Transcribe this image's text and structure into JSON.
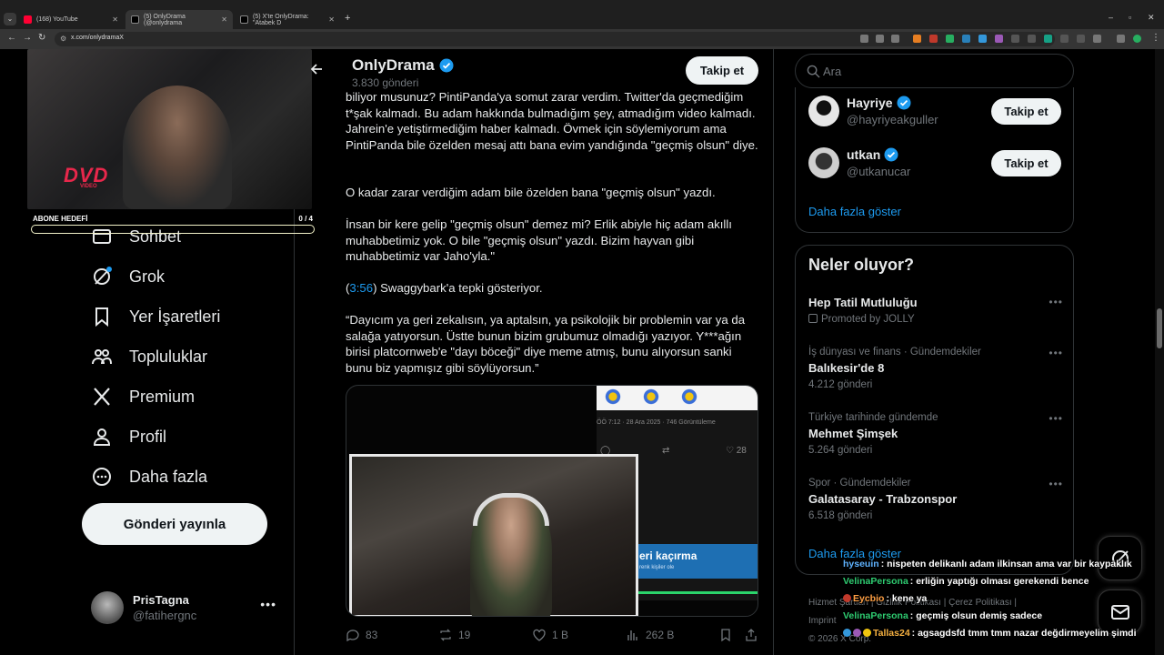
{
  "browser": {
    "tabs": [
      {
        "title": "(168) YouTube",
        "color": "#ff0033"
      },
      {
        "title": "(5) OnlyDrama (@onlydrama",
        "color": "#ffffff"
      },
      {
        "title": "(5) X'te OnlyDrama: \"Atabek D",
        "color": "#ffffff"
      }
    ],
    "url": "x.com/onlydramaX"
  },
  "stream": {
    "logo_text": "DVD",
    "logo_sub": "VIDEO",
    "goal_label": "ABONE HEDEFİ",
    "goal_count": "0 / 4",
    "goal_progress": 0
  },
  "nav": {
    "items": [
      "Sohbet",
      "Grok",
      "Yer İşaretleri",
      "Topluluklar",
      "Premium",
      "Profil",
      "Daha fazla"
    ],
    "post_button": "Gönderi yayınla",
    "account_name": "PrisTagna",
    "account_handle": "@fatihergnc"
  },
  "profile": {
    "name": "OnlyDrama",
    "posts": "3.830 gönderi",
    "follow": "Takip et"
  },
  "tweet": {
    "p1": "biliyor musunuz? PintiPanda'ya somut zarar verdim. Twitter'da geçmediğim t*şak kalmadı. Bu adam hakkında bulmadığım şey, atmadığım video kalmadı. Jahrein'e yetiştirmediğim haber kalmadı. Övmek için söylemiyorum ama PintiPanda bile özelden mesaj attı bana evim yandığında \"geçmiş olsun\" diye.",
    "p2": "O kadar zarar verdiğim adam bile özelden bana \"geçmiş olsun\" yazdı.",
    "p3": "İnsan bir kere gelip \"geçmiş olsun\" demez mi? Erlik abiyle hiç adam akıllı muhabbetimiz yok. O bile \"geçmiş olsun\" yazdı. Bizim hayvan gibi muhabbetimiz var Jaho'yla.\"",
    "p4_open": "(",
    "p4_time": "3:56",
    "p4_rest": ") Swaggybark'a tepki gösteriyor.",
    "p5": "“Dayıcım ya geri zekalısın, ya aptalsın, ya psikolojik bir problemin var ya da salağa yatıyorsun. Üstte bunun bizim grubumuz olmadığı yazıyor. Y***ağın birisi platcornweb'e \"dayı böceği\" diye meme atmış, bunu alıyorsun sanki bunu biz yapmışız gibi söylüyorsun.”",
    "media": {
      "meta": "ÖÖ 7:12 · 28 Ara 2025 · 746 Görüntüleme",
      "reposts": "28",
      "banner_title": "eri kaçırma",
      "banner_sub": "renk kişiler ole"
    },
    "stats": {
      "replies": "83",
      "reposts": "19",
      "likes": "1 B",
      "views": "262 B"
    }
  },
  "right": {
    "search_placeholder": "Ara",
    "who_to_follow": [
      {
        "name": "Hayriye",
        "handle": "@hayriyeakguller",
        "follow": "Takip et"
      },
      {
        "name": "utkan",
        "handle": "@utkanucar",
        "follow": "Takip et"
      }
    ],
    "show_more": "Daha fazla göster",
    "trends_title": "Neler oluyor?",
    "trends": [
      {
        "context": "",
        "name": "Hep Tatil Mutluluğu",
        "count": "Promoted by JOLLY"
      },
      {
        "context": "İş dünyası ve finans · Gündemdekiler",
        "name": "Balıkesir'de 8",
        "count": "4.212 gönderi"
      },
      {
        "context": "Türkiye tarihinde gündemde",
        "name": "Mehmet Şimşek",
        "count": "5.264 gönderi"
      },
      {
        "context": "Spor · Gündemdekiler",
        "name": "Galatasaray - Trabzonspor",
        "count": "6.518 gönderi"
      }
    ],
    "trends_show_more": "Daha fazla göster",
    "footer": [
      "Hizmet Şartları",
      "Gizlilik Politikası",
      "Çerez Politikası",
      "Imprint",
      "© 2026 X Corp."
    ]
  },
  "chat": [
    {
      "user": "hyseuin",
      "color": "#5fb3ff",
      "msg": ": nispeten delikanlı adam ilkinsan ama var bir kaypaklık"
    },
    {
      "user": "VelinaPersona",
      "color": "#2ecc71",
      "msg": ": erliğin yaptığı olması gerekendi bence"
    },
    {
      "user": "Eycbio",
      "color": "#ff9f43",
      "msg": ": kene ya"
    },
    {
      "user": "VelinaPersona",
      "color": "#2ecc71",
      "msg": ": geçmiş olsun demiş sadece"
    },
    {
      "user": "Tallas24",
      "color": "#f5b041",
      "msg": ": agsagdsfd tmm tmm nazar değdirmeyelim şimdi"
    }
  ]
}
